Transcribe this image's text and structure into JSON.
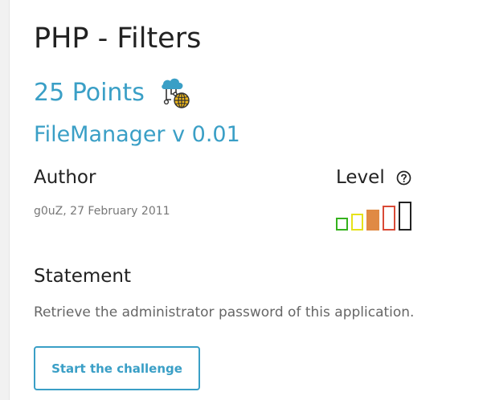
{
  "challenge": {
    "title": "PHP - Filters",
    "points": "25 Points",
    "category_icon": "cloud-network-globe-icon",
    "name": "FileManager v 0.01"
  },
  "author": {
    "label": "Author",
    "meta": "g0uZ,  27 February 2011"
  },
  "level": {
    "label": "Level",
    "help_icon": "question-circle-icon",
    "value": 3,
    "max": 5,
    "colors": [
      "#35b21d",
      "#e6e21a",
      "#e08a44",
      "#d94a36",
      "#222222"
    ]
  },
  "statement": {
    "label": "Statement",
    "text": "Retrieve the administrator password of this application."
  },
  "actions": {
    "start_label": "Start the challenge"
  }
}
